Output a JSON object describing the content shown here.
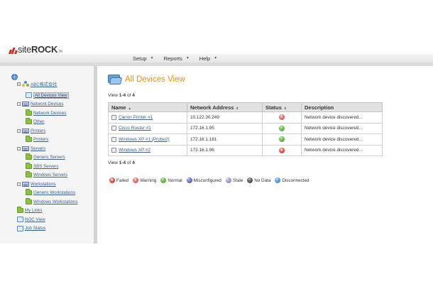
{
  "brand": {
    "prefix": "site",
    "suffix": "ROCK",
    "tm": "TM"
  },
  "menu": [
    {
      "label": "Setup"
    },
    {
      "label": "Reports"
    },
    {
      "label": "Help"
    }
  ],
  "sidebar": {
    "org": "ABC株式会社",
    "items": [
      {
        "label": "All Devices View",
        "level": 2,
        "icon": "devices-icon",
        "selected": true
      },
      {
        "label": "Network Devices",
        "level": 1,
        "icon": "group-icon",
        "toggle": "-"
      },
      {
        "label": "Network Devices",
        "level": 2,
        "icon": "folder-icon"
      },
      {
        "label": "Other",
        "level": 2,
        "icon": "folder-icon"
      },
      {
        "label": "Printers",
        "level": 1,
        "icon": "group-icon",
        "toggle": "-"
      },
      {
        "label": "Printers",
        "level": 2,
        "icon": "folder-icon"
      },
      {
        "label": "Servers",
        "level": 1,
        "icon": "group-icon",
        "toggle": "-"
      },
      {
        "label": "Generic Servers",
        "level": 2,
        "icon": "folder-icon"
      },
      {
        "label": "SBS Servers",
        "level": 2,
        "icon": "folder-icon"
      },
      {
        "label": "Windows Servers",
        "level": 2,
        "icon": "folder-icon"
      },
      {
        "label": "Workstations",
        "level": 1,
        "icon": "group-icon",
        "toggle": "-"
      },
      {
        "label": "Generic Workstations",
        "level": 2,
        "icon": "folder-icon"
      },
      {
        "label": "Windows Workstations",
        "level": 2,
        "icon": "folder-icon"
      },
      {
        "label": "My Links",
        "level": 1,
        "icon": "folder-icon"
      },
      {
        "label": "NOC View",
        "level": 1,
        "icon": "doc-icon"
      },
      {
        "label": "Job Status",
        "level": 1,
        "icon": "doc-icon"
      }
    ]
  },
  "main": {
    "title": "All Devices View",
    "pager": {
      "prefix": "View ",
      "range": "1-4",
      "of": " of ",
      "total": "4"
    },
    "columns": [
      {
        "label": "Name",
        "sort": "▲"
      },
      {
        "label": "Network Address",
        "sort": "⇕"
      },
      {
        "label": "Status",
        "sort": "⇕"
      },
      {
        "label": "Description",
        "sort": ""
      }
    ],
    "rows": [
      {
        "name": "Canon Printer #1",
        "address": "10.122.30.249",
        "status": "warning",
        "description": "Network device discovered..."
      },
      {
        "name": "Cisco Router #1",
        "address": "172.16.1.95",
        "status": "normal",
        "description": "Network device discovered..."
      },
      {
        "name": "Windows XP #1 (Probe2)",
        "address": "172.16.1.181",
        "status": "normal",
        "description": "Network device discovered..."
      },
      {
        "name": "Windows XP #2",
        "address": "172.16.1.96",
        "status": "failed",
        "description": "Network device discovered..."
      }
    ]
  },
  "legend": [
    {
      "key": "failed",
      "label": "Failed",
      "glyph": "×"
    },
    {
      "key": "warning",
      "label": "Warning",
      "glyph": "!"
    },
    {
      "key": "normal",
      "label": "Normal",
      "glyph": ""
    },
    {
      "key": "misconfigured",
      "label": "Misconfigured",
      "glyph": ""
    },
    {
      "key": "stale",
      "label": "Stale",
      "glyph": ""
    },
    {
      "key": "nodata",
      "label": "No Data",
      "glyph": ""
    },
    {
      "key": "disconnected",
      "label": "Disconnected",
      "glyph": ""
    }
  ]
}
